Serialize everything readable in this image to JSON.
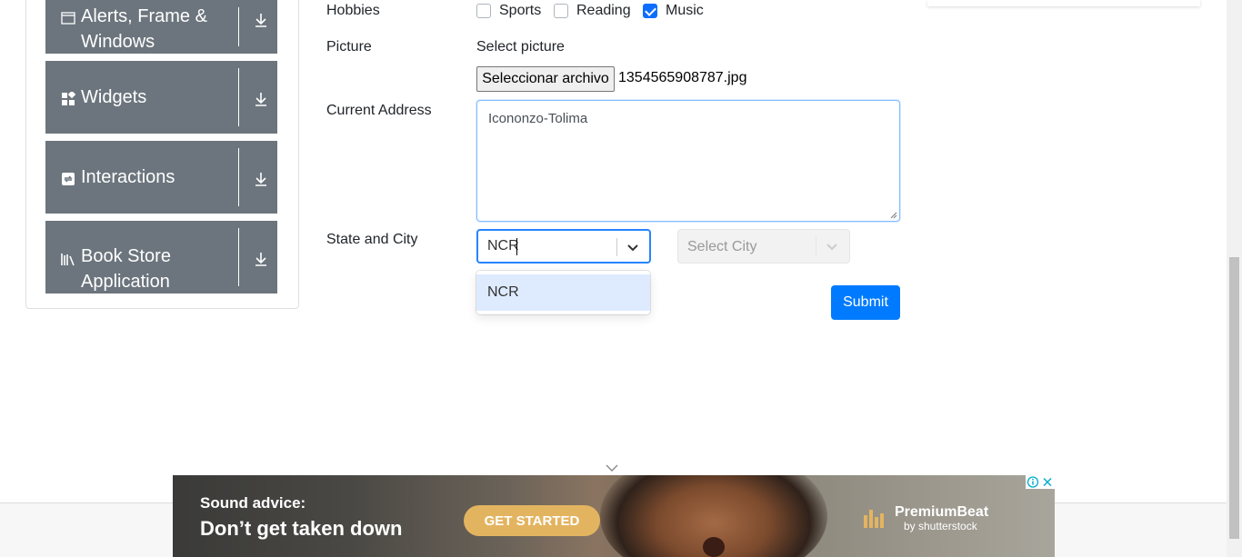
{
  "sidebar": {
    "groups": [
      {
        "label": "Alerts, Frame & Windows",
        "line1": "Alerts, Frame &",
        "line2": "Windows",
        "icon": "window-icon"
      },
      {
        "label": "Widgets",
        "icon": "widgets-icon"
      },
      {
        "label": "Interactions",
        "icon": "interactions-icon"
      },
      {
        "label": "Book Store Application",
        "line1": "Book Store",
        "line2": "Application",
        "icon": "bookstore-icon"
      }
    ]
  },
  "form": {
    "hobbies_label": "Hobbies",
    "hobbies": [
      {
        "label": "Sports",
        "checked": false
      },
      {
        "label": "Reading",
        "checked": false
      },
      {
        "label": "Music",
        "checked": true
      }
    ],
    "picture_label": "Picture",
    "picture_hint": "Select picture",
    "file_button": "Seleccionar archivo",
    "file_name": "1354565908787.jpg",
    "address_label": "Current Address",
    "address_value": "Icononzo-Tolima",
    "state_city_label": "State and City",
    "state_value": "NCR",
    "city_placeholder": "Select City",
    "state_options": [
      "NCR"
    ],
    "submit_label": "Submit"
  },
  "ad": {
    "line1": "Sound advice:",
    "line2": "Don’t get taken down",
    "cta": "GET STARTED",
    "brand": "PremiumBeat",
    "brand_sub": "by shutterstock"
  },
  "colors": {
    "sidebar_bg": "#6c757d",
    "primary": "#007bff",
    "focus": "#2684ff",
    "option_highlight": "#deebff",
    "ad_cta": "#e3b460"
  }
}
